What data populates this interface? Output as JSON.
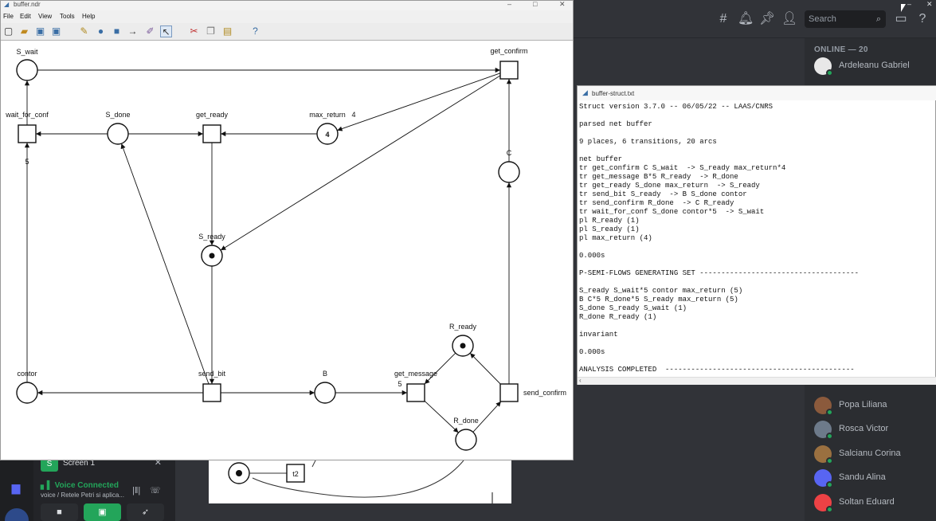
{
  "main_window": {
    "title": "buffer.ndr",
    "menu": [
      "File",
      "Edit",
      "View",
      "Tools",
      "Help"
    ],
    "toolbar_icons": [
      "new-icon",
      "open-icon",
      "save-icon",
      "save-as-icon",
      "edit-icon",
      "place-tool-icon",
      "transition-tool-icon",
      "arc-tool-icon",
      "script-icon",
      "select-icon",
      "cut-icon",
      "copy-icon",
      "paste-icon",
      "help-icon"
    ]
  },
  "net": {
    "places": [
      {
        "id": "S_wait",
        "label": "S_wait",
        "tokens": 0
      },
      {
        "id": "S_done",
        "label": "S_done",
        "tokens": 0
      },
      {
        "id": "max_return",
        "label": "max_return",
        "tokens_label": "4",
        "side_label": "4"
      },
      {
        "id": "S_ready",
        "label": "S_ready",
        "tokens": 1
      },
      {
        "id": "C",
        "label": "C",
        "tokens": 0
      },
      {
        "id": "R_ready",
        "label": "R_ready",
        "tokens": 1
      },
      {
        "id": "contor",
        "label": "contor",
        "tokens": 0
      },
      {
        "id": "B",
        "label": "B",
        "tokens": 0
      },
      {
        "id": "R_done",
        "label": "R_done",
        "tokens": 0
      }
    ],
    "transitions": [
      {
        "id": "get_confirm",
        "label": "get_confirm"
      },
      {
        "id": "wait_for_conf",
        "label": "wait_for_conf"
      },
      {
        "id": "get_ready",
        "label": "get_ready"
      },
      {
        "id": "send_bit",
        "label": "send_bit"
      },
      {
        "id": "get_message",
        "label": "get_message"
      },
      {
        "id": "send_confirm",
        "label": "send_confirm"
      }
    ],
    "arc_weights": {
      "contor_to_wait_for_conf": "5",
      "B_to_get_message": "5"
    }
  },
  "text_window": {
    "title": "buffer-struct.txt",
    "lines": [
      "Struct version 3.7.0 -- 06/05/22 -- LAAS/CNRS",
      "",
      "parsed net buffer",
      "",
      "9 places, 6 transitions, 20 arcs",
      "",
      "net buffer",
      "tr get_confirm C S_wait  -> S_ready max_return*4",
      "tr get_message B*5 R_ready  -> R_done",
      "tr get_ready S_done max_return  -> S_ready",
      "tr send_bit S_ready  -> B S_done contor",
      "tr send_confirm R_done  -> C R_ready",
      "tr wait_for_conf S_done contor*5  -> S_wait",
      "pl R_ready (1)",
      "pl S_ready (1)",
      "pl max_return (4)",
      "",
      "0.000s",
      "",
      "P-SEMI-FLOWS GENERATING SET -------------------------------------",
      "",
      "S_ready S_wait*5 contor max_return (5)",
      "B C*5 R_done*5 S_ready max_return (5)",
      "S_done S_ready S_wait (1)",
      "R_done R_ready (1)",
      "",
      "invariant",
      "",
      "0.000s",
      "",
      "ANALYSIS COMPLETED  --------------------------------------------"
    ]
  },
  "discord": {
    "search_placeholder": "Search",
    "online_header": "ONLINE — 20",
    "members": [
      {
        "name": "Ardeleanu Gabriel",
        "color": "#e8e8e8"
      },
      {
        "name": "Popa Liliana",
        "color": "#8b5a3c"
      },
      {
        "name": "Rosca Victor",
        "color": "#6d7a8a"
      },
      {
        "name": "Salcianu Corina",
        "color": "#9a7040"
      },
      {
        "name": "Sandu Alina",
        "color": "#5865f2"
      },
      {
        "name": "Soltan Eduard",
        "color": "#ed4245"
      }
    ],
    "screen_share_label": "Screen 1",
    "voice_status": "Voice Connected",
    "voice_channel": "voice / Retele Petri si aplica...",
    "background_transition_label": "t2"
  }
}
